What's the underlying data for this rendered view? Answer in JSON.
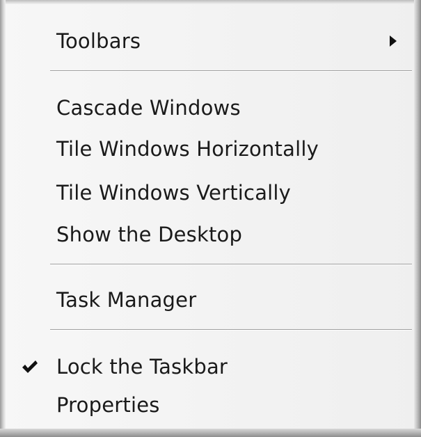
{
  "menu": {
    "toolbars": "Toolbars",
    "cascade": "Cascade Windows",
    "tile_h": "Tile Windows Horizontally",
    "tile_v": "Tile Windows Vertically",
    "show_desktop": "Show the Desktop",
    "task_manager": "Task Manager",
    "lock_taskbar": "Lock the Taskbar",
    "properties": "Properties"
  },
  "state": {
    "lock_taskbar_checked": true
  },
  "icons": {
    "submenu_arrow": "chevron-right-icon",
    "check": "check-icon"
  },
  "colors": {
    "menu_bg": "#f2f2f2",
    "text": "#1a1a1a",
    "separator": "#9f9f9f"
  }
}
